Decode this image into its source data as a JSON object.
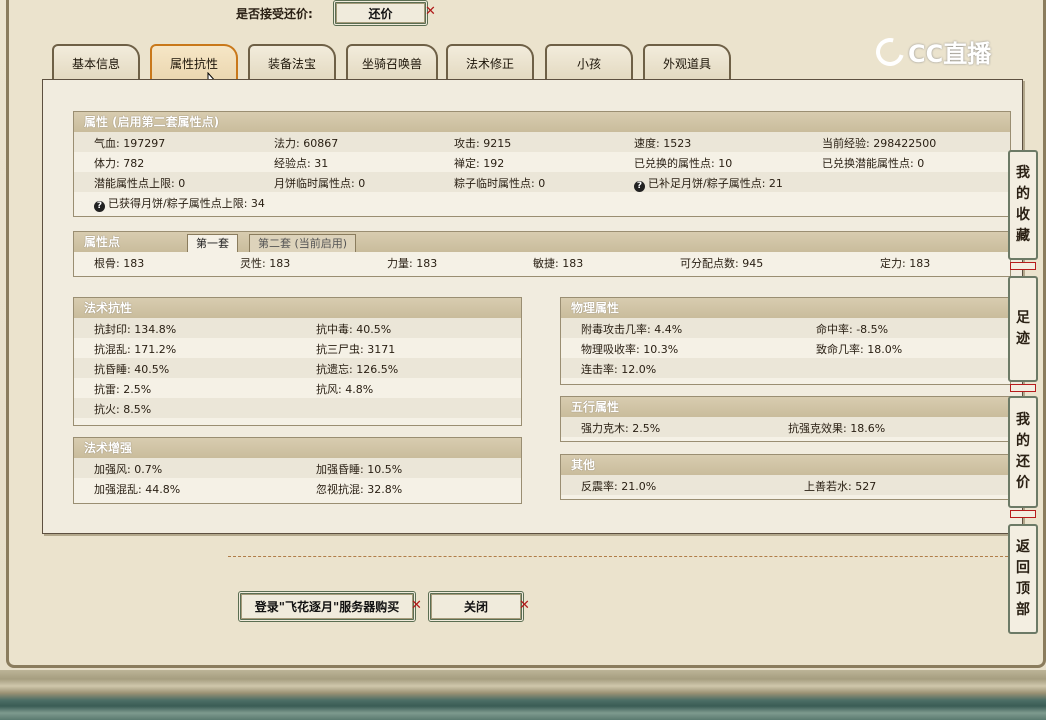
{
  "offer": {
    "label": "是否接受还价:",
    "button": "还价"
  },
  "tabs": [
    "基本信息",
    "属性抗性",
    "装备法宝",
    "坐骑召唤兽",
    "法术修正",
    "小孩",
    "外观道具"
  ],
  "active_tab": 1,
  "logo": {
    "text": "CC直播"
  },
  "attrs": {
    "title": "属性 (启用第二套属性点)",
    "rows": [
      [
        "气血: 197297",
        "法力: 60867",
        "攻击: 9215",
        "速度: 1523",
        "当前经验: 298422500"
      ],
      [
        "体力: 782",
        "经验点: 31",
        "禅定: 192",
        "已兑换的属性点: 10",
        "已兑换潜能属性点: 0"
      ],
      [
        "潜能属性点上限: 0",
        "月饼临时属性点: 0",
        "粽子临时属性点: 0",
        "已补足月饼/粽子属性点: 21",
        ""
      ]
    ],
    "extra": "已获得月饼/粽子属性点上限: 34"
  },
  "points": {
    "title": "属性点",
    "tab1": "第一套",
    "tab2": "第二套 (当前启用)",
    "values": [
      "根骨: 183",
      "灵性: 183",
      "力量: 183",
      "敏捷: 183",
      "可分配点数: 945",
      "定力: 183"
    ]
  },
  "magic_resist": {
    "title": "法术抗性",
    "rows": [
      [
        "抗封印: 134.8%",
        "抗中毒: 40.5%"
      ],
      [
        "抗混乱: 171.2%",
        "抗三尸虫: 3171"
      ],
      [
        "抗昏睡: 40.5%",
        "抗遗忘: 126.5%"
      ],
      [
        "抗雷: 2.5%",
        "抗风: 4.8%"
      ],
      [
        "抗火: 8.5%",
        ""
      ]
    ]
  },
  "magic_boost": {
    "title": "法术增强",
    "rows": [
      [
        "加强风: 0.7%",
        "加强昏睡: 10.5%"
      ],
      [
        "加强混乱: 44.8%",
        "忽视抗混: 32.8%"
      ]
    ]
  },
  "physical": {
    "title": "物理属性",
    "rows": [
      [
        "附毒攻击几率: 4.4%",
        "命中率: -8.5%"
      ],
      [
        "物理吸收率: 10.3%",
        "致命几率: 18.0%"
      ],
      [
        "连击率: 12.0%",
        ""
      ]
    ]
  },
  "five_elements": {
    "title": "五行属性",
    "rows": [
      [
        "强力克木: 2.5%",
        "抗强克效果: 18.6%"
      ]
    ]
  },
  "other": {
    "title": "其他",
    "rows": [
      [
        "反震率: 21.0%",
        "上善若水: 527"
      ]
    ]
  },
  "buttons": {
    "login": "登录\"飞花逐月\"服务器购买",
    "close": "关闭"
  },
  "side": [
    [
      "我",
      "的",
      "收",
      "藏"
    ],
    [
      "足",
      "迹"
    ],
    [
      "我",
      "的",
      "还",
      "价"
    ],
    [
      "返",
      "回",
      "顶",
      "部"
    ]
  ]
}
